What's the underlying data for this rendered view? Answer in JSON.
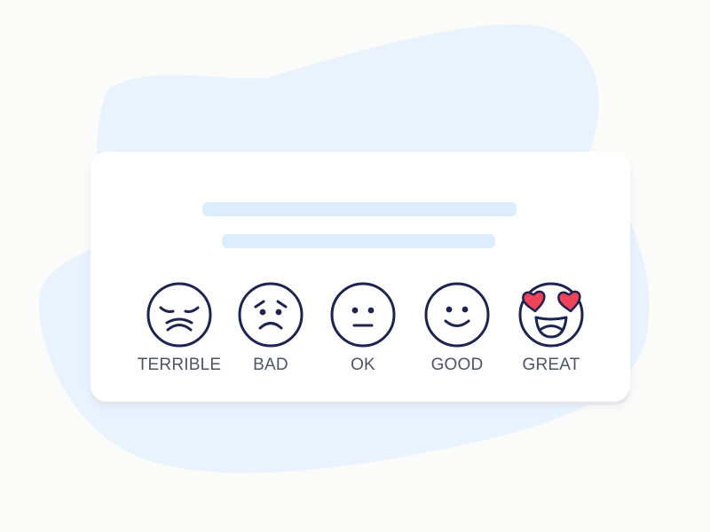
{
  "colors": {
    "background": "#fbfbf9",
    "blob": "#e8f3fe",
    "card": "#ffffff",
    "placeholder": "#dcedfd",
    "face_stroke": "#1e2450",
    "heart": "#ef4359",
    "label": "#4e5464"
  },
  "rating": {
    "options": [
      {
        "label": "TERRIBLE",
        "icon": "sad-sleepy-face-icon"
      },
      {
        "label": "BAD",
        "icon": "frowning-face-icon"
      },
      {
        "label": "OK",
        "icon": "neutral-face-icon"
      },
      {
        "label": "GOOD",
        "icon": "smiling-face-icon"
      },
      {
        "label": "GREAT",
        "icon": "heart-eyes-face-icon"
      }
    ]
  }
}
